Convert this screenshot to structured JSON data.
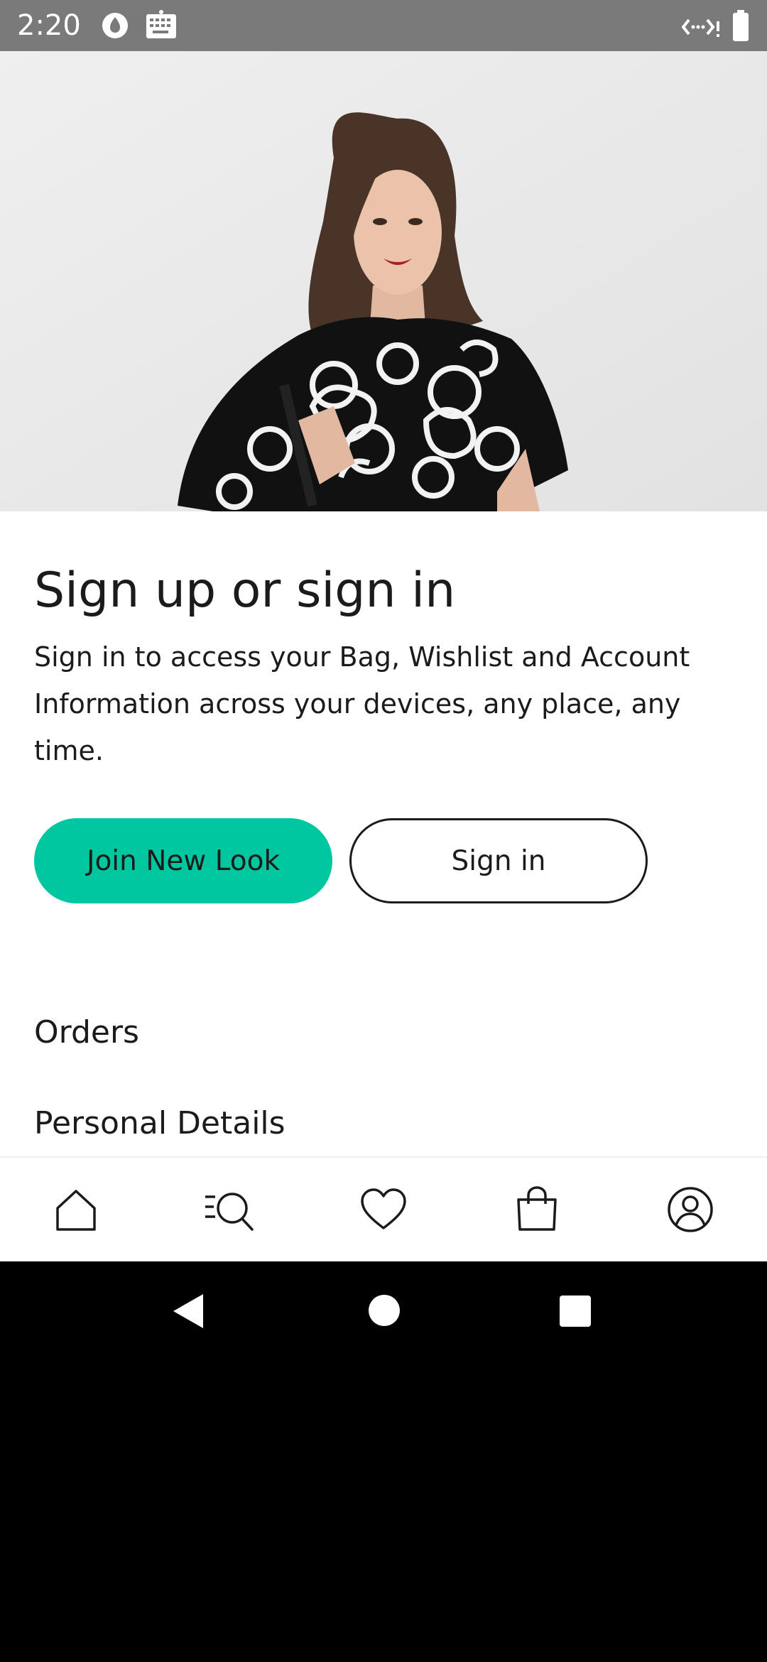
{
  "status_bar": {
    "time": "2:20",
    "left_icons": [
      "water-drop-icon",
      "keyboard-icon"
    ],
    "right_icons": [
      "data-arrows-icon",
      "battery-icon"
    ]
  },
  "hero": {
    "image": "woman-in-floral-tshirt-photo"
  },
  "sign_in_panel": {
    "title": "Sign up or sign in",
    "description": "Sign in to access your Bag, Wishlist and Account Information across your devices, any place, any time.",
    "join_label": "Join New Look",
    "signin_label": "Sign in"
  },
  "menu": {
    "items": [
      {
        "label": "Orders"
      },
      {
        "label": "Personal Details"
      }
    ]
  },
  "bottom_nav": {
    "items": [
      {
        "icon": "home-icon"
      },
      {
        "icon": "search-icon"
      },
      {
        "icon": "heart-icon"
      },
      {
        "icon": "shopping-bag-icon"
      },
      {
        "icon": "account-icon"
      }
    ]
  },
  "system_nav": {
    "items": [
      "back-icon",
      "home-circle-icon",
      "recents-icon"
    ]
  },
  "colors": {
    "accent": "#00c7a0",
    "text": "#1b1b1b",
    "status_bar": "#7a7a7a"
  }
}
